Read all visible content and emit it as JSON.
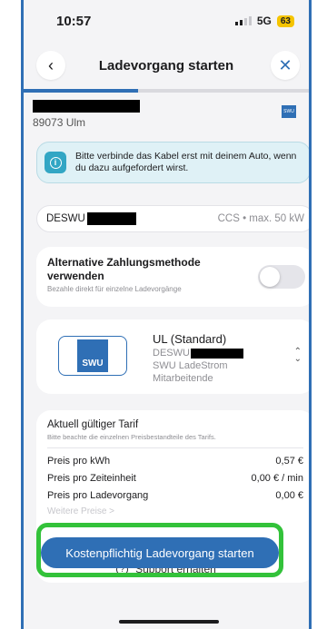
{
  "status_bar": {
    "time": "10:57",
    "network": "5G",
    "battery": "63"
  },
  "nav": {
    "title": "Ladevorgang starten"
  },
  "progress": {
    "fraction": 0.4
  },
  "station": {
    "address": "89073 Ulm",
    "logo_text": "SWU"
  },
  "info": {
    "message": "Bitte verbinde das Kabel erst mit deinem Auto, wenn du dazu aufgefordert wirst."
  },
  "connector": {
    "name": "DESWU",
    "spec": "CCS • max. 50 kW"
  },
  "alt_payment": {
    "title": "Alternative Zahlungsmethode verwenden",
    "subtitle": "Bezahle direkt für einzelne Ladevorgänge",
    "enabled": false
  },
  "tariff": {
    "logo_text": "SWU",
    "name": "UL (Standard)",
    "id_prefix": "DESWU",
    "product": "SWU LadeStrom",
    "group": "Mitarbeitende"
  },
  "prices": {
    "title": "Aktuell gültiger Tarif",
    "subtitle": "Bitte beachte die einzelnen Preisbestandteile des Tarifs.",
    "rows": [
      {
        "label": "Preis pro kWh",
        "value": "0,57 €"
      },
      {
        "label": "Preis pro Zeiteinheit",
        "value": "0,00 € / min"
      },
      {
        "label": "Preis pro Ladevorgang",
        "value": "0,00 €"
      }
    ],
    "more": "Weitere Preise >"
  },
  "cta": {
    "label": "Kostenpflichtig Ladevorgang starten"
  },
  "support": {
    "label": "Support erhalten"
  },
  "colors": {
    "accent": "#2f6fb5",
    "highlight": "#33c23a",
    "info_bg": "#dff1f6"
  }
}
